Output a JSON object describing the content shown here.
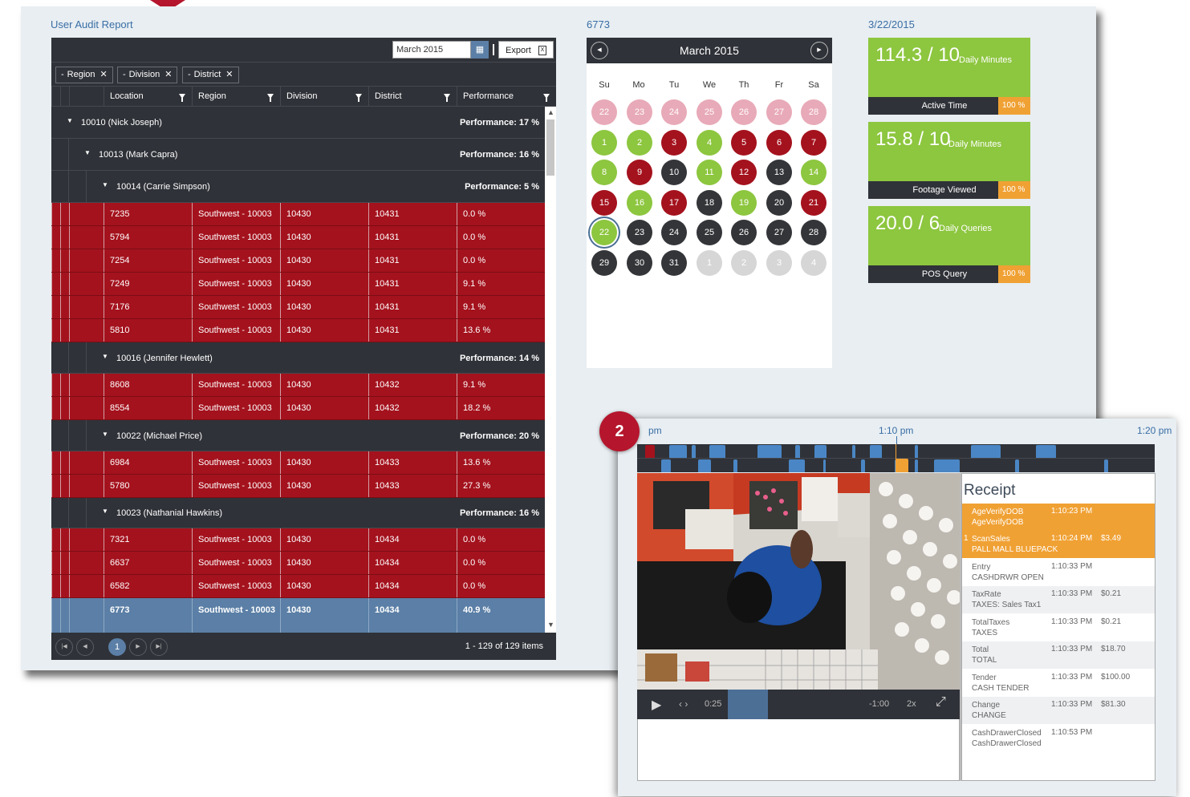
{
  "titles": {
    "report": "User Audit Report",
    "location_id": "6773",
    "date": "3/22/2015"
  },
  "toolbar": {
    "month_value": "March 2015",
    "export_label": "Export"
  },
  "group_chips": [
    "Region",
    "Division",
    "District"
  ],
  "columns": [
    "Location",
    "Region",
    "Division",
    "District",
    "Performance"
  ],
  "groups": [
    {
      "label": "10010 (Nick Joseph)",
      "perf": "Performance: 17 %"
    },
    {
      "label": "10013 (Mark Capra)",
      "perf": "Performance: 16 %"
    },
    {
      "label": "10014 (Carrie Simpson)",
      "perf": "Performance: 5 %"
    },
    {
      "label": "10016 (Jennifer Hewlett)",
      "perf": "Performance: 14 %"
    },
    {
      "label": "10022 (Michael Price)",
      "perf": "Performance: 20 %"
    },
    {
      "label": "10023 (Nathanial Hawkins)",
      "perf": "Performance: 16 %"
    }
  ],
  "rows": [
    [
      "7235",
      "Southwest - 10003",
      "10430",
      "10431",
      "0.0 %"
    ],
    [
      "5794",
      "Southwest - 10003",
      "10430",
      "10431",
      "0.0 %"
    ],
    [
      "7254",
      "Southwest - 10003",
      "10430",
      "10431",
      "0.0 %"
    ],
    [
      "7249",
      "Southwest - 10003",
      "10430",
      "10431",
      "9.1 %"
    ],
    [
      "7176",
      "Southwest - 10003",
      "10430",
      "10431",
      "9.1 %"
    ],
    [
      "5810",
      "Southwest - 10003",
      "10430",
      "10431",
      "13.6 %"
    ],
    [
      "8608",
      "Southwest - 10003",
      "10430",
      "10432",
      "9.1 %"
    ],
    [
      "8554",
      "Southwest - 10003",
      "10430",
      "10432",
      "18.2 %"
    ],
    [
      "6984",
      "Southwest - 10003",
      "10430",
      "10433",
      "13.6 %"
    ],
    [
      "5780",
      "Southwest - 10003",
      "10430",
      "10433",
      "27.3 %"
    ],
    [
      "7321",
      "Southwest - 10003",
      "10430",
      "10434",
      "0.0 %"
    ],
    [
      "6637",
      "Southwest - 10003",
      "10430",
      "10434",
      "0.0 %"
    ],
    [
      "6582",
      "Southwest - 10003",
      "10430",
      "10434",
      "0.0 %"
    ],
    [
      "6773",
      "Southwest - 10003",
      "10430",
      "10434",
      "40.9 %"
    ]
  ],
  "pager": {
    "current_page": "1",
    "info": "1 - 129 of 129 items"
  },
  "calendar": {
    "title": "March 2015",
    "weekdays": [
      "Su",
      "Mo",
      "Tu",
      "We",
      "Th",
      "Fr",
      "Sa"
    ],
    "days": [
      [
        "22",
        "pink"
      ],
      [
        "23",
        "pink"
      ],
      [
        "24",
        "pink"
      ],
      [
        "25",
        "pink"
      ],
      [
        "26",
        "pink"
      ],
      [
        "27",
        "pink"
      ],
      [
        "28",
        "pink"
      ],
      [
        "1",
        "green"
      ],
      [
        "2",
        "green"
      ],
      [
        "3",
        "red"
      ],
      [
        "4",
        "green"
      ],
      [
        "5",
        "red"
      ],
      [
        "6",
        "red"
      ],
      [
        "7",
        "red"
      ],
      [
        "8",
        "green"
      ],
      [
        "9",
        "red"
      ],
      [
        "10",
        "dark"
      ],
      [
        "11",
        "green"
      ],
      [
        "12",
        "red"
      ],
      [
        "13",
        "dark"
      ],
      [
        "14",
        "green"
      ],
      [
        "15",
        "red"
      ],
      [
        "16",
        "green"
      ],
      [
        "17",
        "red"
      ],
      [
        "18",
        "dark"
      ],
      [
        "19",
        "green"
      ],
      [
        "20",
        "dark"
      ],
      [
        "21",
        "red"
      ],
      [
        "22",
        "today"
      ],
      [
        "23",
        "dark"
      ],
      [
        "24",
        "dark"
      ],
      [
        "25",
        "dark"
      ],
      [
        "26",
        "dark"
      ],
      [
        "27",
        "dark"
      ],
      [
        "28",
        "dark"
      ],
      [
        "29",
        "dark"
      ],
      [
        "30",
        "dark"
      ],
      [
        "31",
        "dark"
      ],
      [
        "1",
        "gray"
      ],
      [
        "2",
        "gray"
      ],
      [
        "3",
        "gray"
      ],
      [
        "4",
        "gray"
      ]
    ]
  },
  "metrics": [
    {
      "value": "114.3 / 10",
      "unit": "Daily Minutes",
      "label": "Active Time",
      "pct": "100 %"
    },
    {
      "value": "15.8 / 10",
      "unit": "Daily Minutes",
      "label": "Footage Viewed",
      "pct": "100 %"
    },
    {
      "value": "20.0 / 6",
      "unit": "Daily Queries",
      "label": "POS Query",
      "pct": "100 %"
    }
  ],
  "player": {
    "badge": "2",
    "time_labels": [
      "pm",
      "1:10 pm",
      "1:20 pm"
    ],
    "play_time": "0:25",
    "remaining": "-1:00",
    "speed": "2x"
  },
  "receipt": {
    "title": "Receipt",
    "items": [
      {
        "qty": "",
        "name": "AgeVerifyDOB",
        "detail": "AgeVerifyDOB",
        "time": "1:10:23 PM",
        "amount": ""
      },
      {
        "qty": "1",
        "name": "ScanSales",
        "detail": "PALL MALL BLUEPACK",
        "time": "1:10:24 PM",
        "amount": "$3.49"
      },
      {
        "qty": "",
        "name": "Entry",
        "detail": "CASHDRWR OPEN",
        "time": "1:10:33 PM",
        "amount": ""
      },
      {
        "qty": "",
        "name": "TaxRate",
        "detail": "TAXES: Sales Tax1",
        "time": "1:10:33 PM",
        "amount": "$0.21"
      },
      {
        "qty": "",
        "name": "TotalTaxes",
        "detail": "TAXES",
        "time": "1:10:33 PM",
        "amount": "$0.21"
      },
      {
        "qty": "",
        "name": "Total",
        "detail": "TOTAL",
        "time": "1:10:33 PM",
        "amount": "$18.70"
      },
      {
        "qty": "",
        "name": "Tender",
        "detail": "CASH TENDER",
        "time": "1:10:33 PM",
        "amount": "$100.00"
      },
      {
        "qty": "",
        "name": "Change",
        "detail": "CHANGE",
        "time": "1:10:33 PM",
        "amount": "$81.30"
      },
      {
        "qty": "",
        "name": "CashDrawerClosed",
        "detail": "CashDrawerClosed",
        "time": "1:10:53 PM",
        "amount": ""
      }
    ]
  },
  "colors": {
    "accent_blue": "#5b7fa6",
    "status_red": "#a4121d",
    "status_green": "#8dc63f",
    "highlight_orange": "#f0a134",
    "badge_red": "#b5162d"
  }
}
